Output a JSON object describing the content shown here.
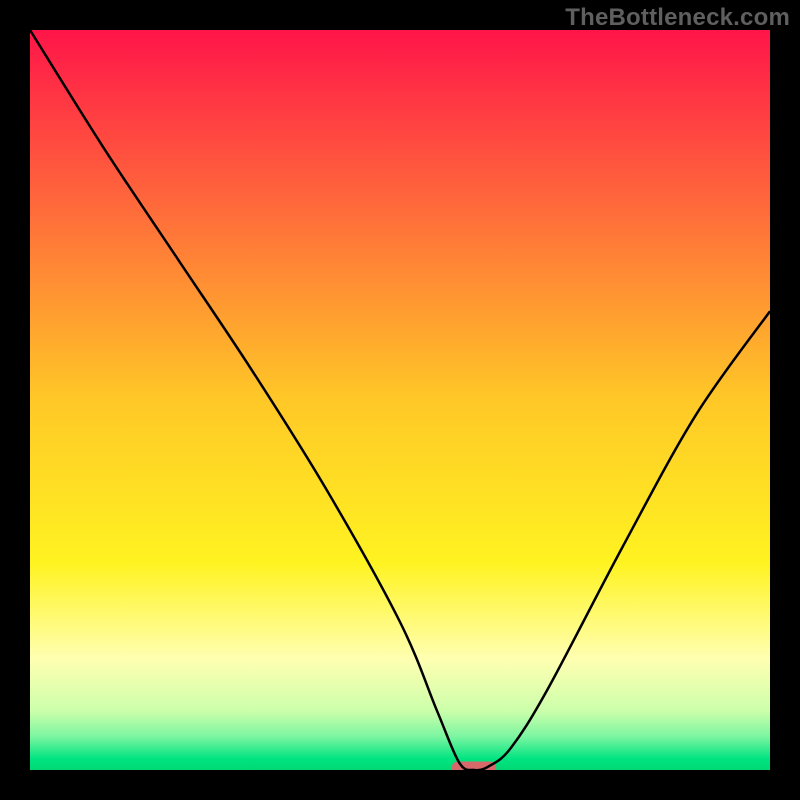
{
  "watermark": "TheBottleneck.com",
  "chart_data": {
    "type": "line",
    "title": "",
    "xlabel": "",
    "ylabel": "",
    "xlim": [
      0,
      100
    ],
    "ylim": [
      0,
      100
    ],
    "series": [
      {
        "name": "bottleneck-curve",
        "x": [
          0,
          10,
          20,
          30,
          40,
          50,
          55,
          58,
          60,
          62,
          65,
          70,
          80,
          90,
          100
        ],
        "values": [
          100,
          84,
          69,
          54,
          38,
          20,
          8,
          1,
          0,
          0.5,
          3,
          11,
          30,
          48,
          62
        ]
      }
    ],
    "marker": {
      "name": "optimal-marker",
      "x": 60,
      "y": 0,
      "width": 6,
      "color": "#d66a6a"
    },
    "background_gradient": {
      "stops": [
        {
          "offset": 0.0,
          "color": "#ff1549"
        },
        {
          "offset": 0.25,
          "color": "#ff6e3a"
        },
        {
          "offset": 0.5,
          "color": "#ffc827"
        },
        {
          "offset": 0.72,
          "color": "#fff321"
        },
        {
          "offset": 0.85,
          "color": "#ffffb1"
        },
        {
          "offset": 0.92,
          "color": "#ccffab"
        },
        {
          "offset": 0.955,
          "color": "#7bf5a1"
        },
        {
          "offset": 0.985,
          "color": "#00e481"
        },
        {
          "offset": 1.0,
          "color": "#00d873"
        }
      ]
    }
  }
}
